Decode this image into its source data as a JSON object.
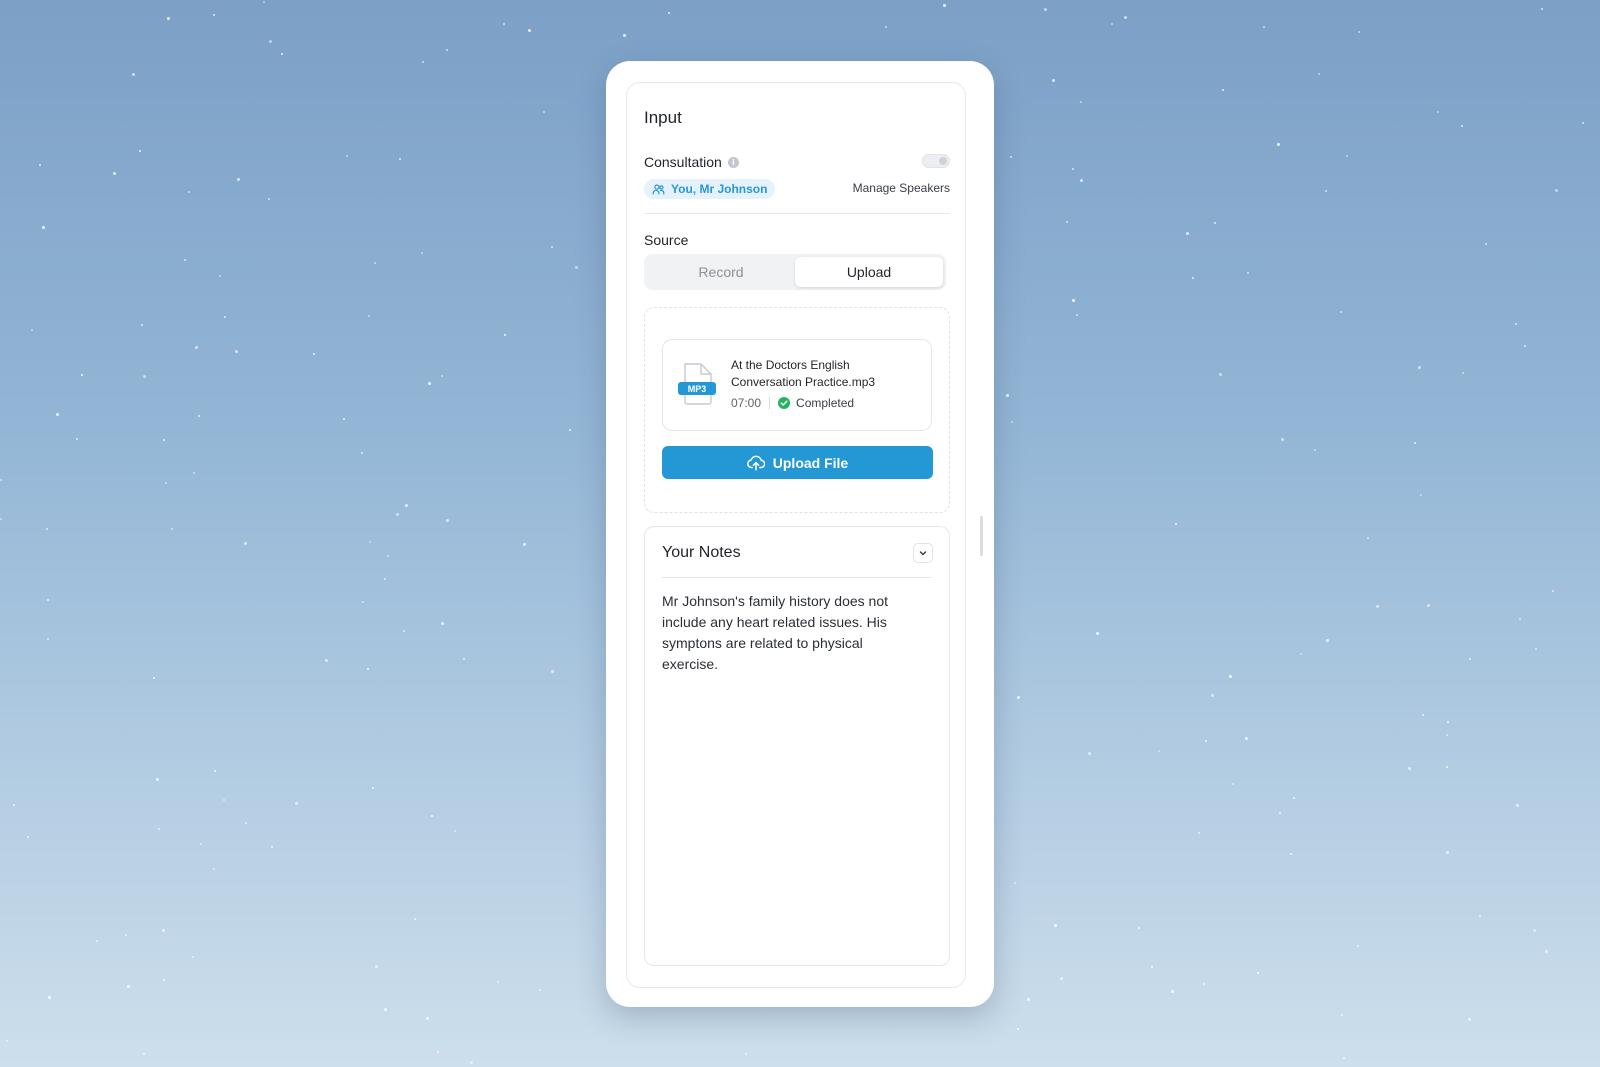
{
  "input": {
    "title": "Input"
  },
  "consultation": {
    "label": "Consultation",
    "info_icon": "info-icon",
    "toggle_on": false,
    "speakers": "You, Mr Johnson",
    "speakers_icon": "people-icon",
    "manage_label": "Manage Speakers"
  },
  "source": {
    "label": "Source",
    "tabs": [
      "Record",
      "Upload"
    ],
    "selected": "Upload"
  },
  "file": {
    "name": "At the Doctors  English Conversation Practice.mp3",
    "type_badge": "MP3",
    "duration": "07:00",
    "status": "Completed",
    "status_color": "#22b35e"
  },
  "upload_button": {
    "label": "Upload File",
    "icon": "cloud-upload-icon",
    "color": "#2497d5"
  },
  "notes": {
    "title": "Your Notes",
    "toggle_icon": "chevron-down-icon",
    "text": "Mr Johnson's family history does not include any heart related issues. His symptons are related to physical exercise."
  }
}
